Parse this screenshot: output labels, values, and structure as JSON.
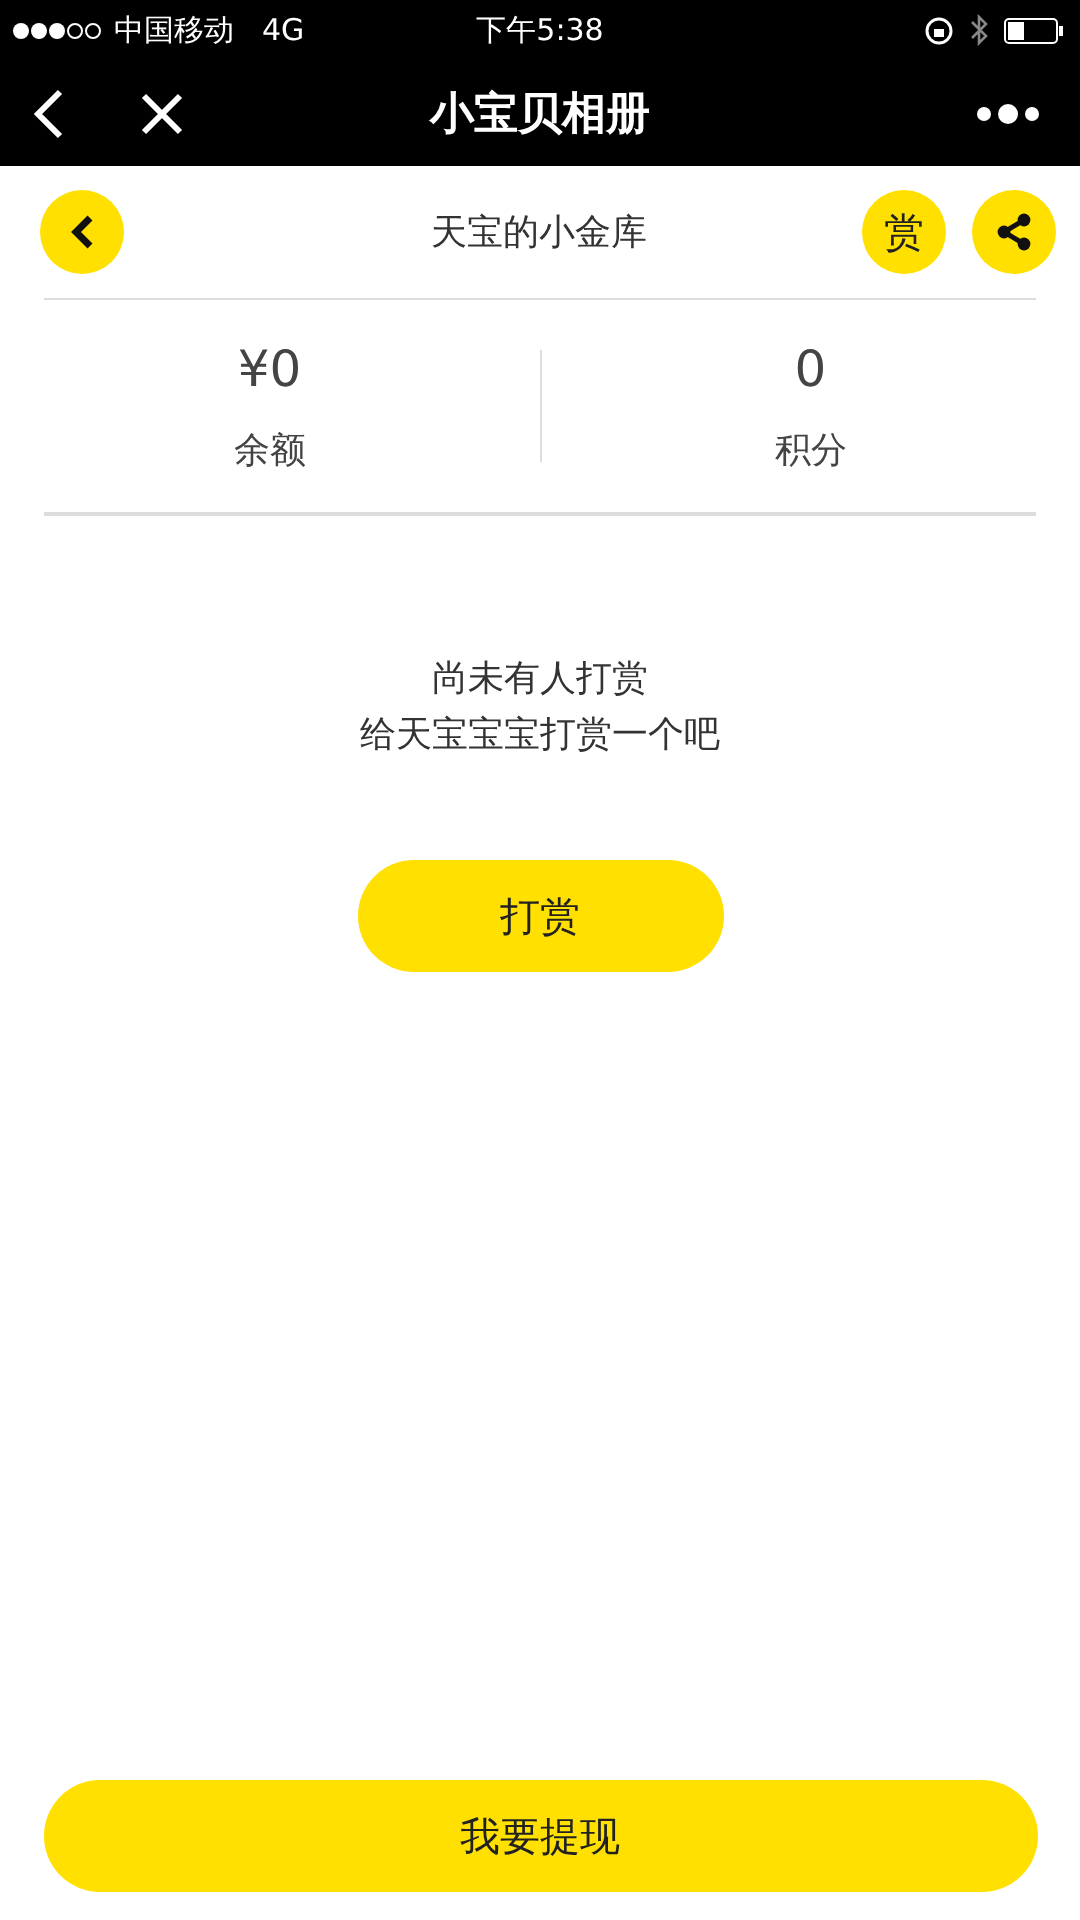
{
  "status_bar": {
    "carrier": "中国移动",
    "network": "4G",
    "time": "下午5:38"
  },
  "nav_bar": {
    "title": "小宝贝相册"
  },
  "header": {
    "title": "天宝的小金库",
    "reward_icon": "赏"
  },
  "stats": [
    {
      "value": "¥0",
      "label": "余额"
    },
    {
      "value": "0",
      "label": "积分"
    }
  ],
  "empty_state": {
    "lines": [
      "尚未有人打赏",
      "给天宝宝宝打赏一个吧"
    ],
    "button": "打赏"
  },
  "footer_button": "我要提现"
}
